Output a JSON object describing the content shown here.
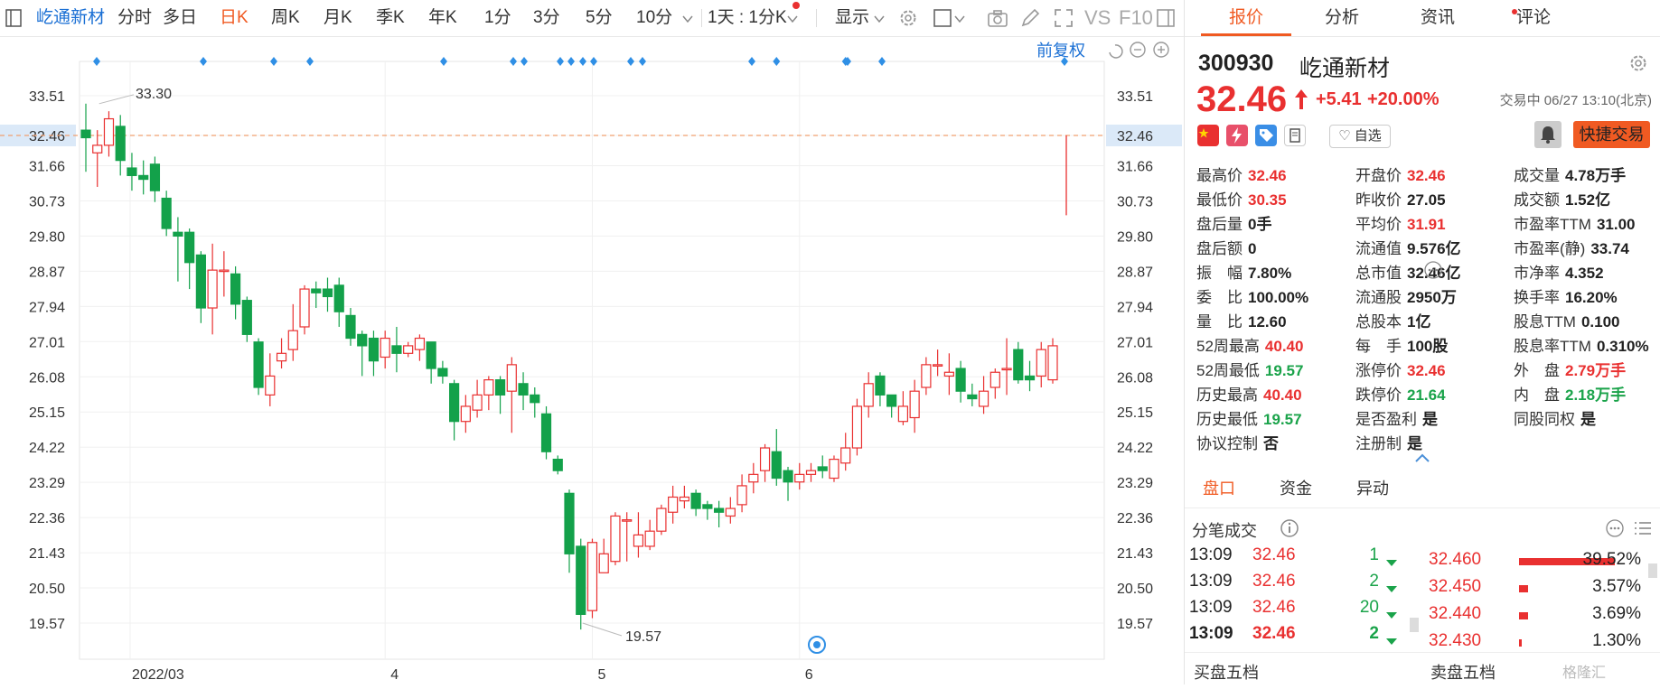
{
  "toolbar": {
    "stock_name": "屹通新材",
    "periods": [
      "分时",
      "多日",
      "日K",
      "周K",
      "月K",
      "季K",
      "年K",
      "1分",
      "3分",
      "5分",
      "10分"
    ],
    "active_period": "日K",
    "day_select": "1天 : 1分K",
    "display": "显示",
    "vs": "VS",
    "f10": "F10"
  },
  "chart": {
    "fuquan": "前复权",
    "current_price_label": "32.46",
    "max_label": "33.30",
    "min_label": "19.57",
    "accent_up": "#e93030",
    "accent_down": "#13a14a",
    "price_line_color": "#f0a070"
  },
  "chart_data": {
    "type": "candlestick",
    "y_ticks": [
      33.51,
      32.46,
      31.66,
      30.73,
      29.8,
      28.87,
      27.94,
      27.01,
      26.08,
      25.15,
      24.22,
      23.29,
      22.36,
      21.43,
      20.5,
      19.57
    ],
    "ylim": [
      19.06,
      34.27
    ],
    "x_labels": [
      {
        "index": 4,
        "label": "2022/03"
      },
      {
        "index": 26,
        "label": "4"
      },
      {
        "index": 44,
        "label": "5"
      },
      {
        "index": 62,
        "label": "6"
      }
    ],
    "candles": [
      [
        32.6,
        32.4,
        33.3,
        31.5
      ],
      [
        32.0,
        32.2,
        32.6,
        31.1
      ],
      [
        32.2,
        32.9,
        33.1,
        31.9
      ],
      [
        32.7,
        31.8,
        33.0,
        31.4
      ],
      [
        31.6,
        31.4,
        32.0,
        31.0
      ],
      [
        31.4,
        31.3,
        31.8,
        30.9
      ],
      [
        31.7,
        31.0,
        31.9,
        30.7
      ],
      [
        30.8,
        30.0,
        31.0,
        29.8
      ],
      [
        29.9,
        29.8,
        30.3,
        28.6
      ],
      [
        29.9,
        29.1,
        30.0,
        28.4
      ],
      [
        29.3,
        27.9,
        29.4,
        27.5
      ],
      [
        27.9,
        28.9,
        29.6,
        27.2
      ],
      [
        28.9,
        28.9,
        29.4,
        28.2
      ],
      [
        28.8,
        28.0,
        29.0,
        27.6
      ],
      [
        28.1,
        27.2,
        28.2,
        27.0
      ],
      [
        27.0,
        25.8,
        27.1,
        25.6
      ],
      [
        25.6,
        26.1,
        26.7,
        25.3
      ],
      [
        26.5,
        26.7,
        27.1,
        26.3
      ],
      [
        26.8,
        27.3,
        28.0,
        26.5
      ],
      [
        27.4,
        28.4,
        28.5,
        27.2
      ],
      [
        28.4,
        28.3,
        28.6,
        27.9
      ],
      [
        28.4,
        28.2,
        28.7,
        27.8
      ],
      [
        28.5,
        27.8,
        28.7,
        27.4
      ],
      [
        27.7,
        27.1,
        27.9,
        26.9
      ],
      [
        27.2,
        26.9,
        27.3,
        26.1
      ],
      [
        27.1,
        26.5,
        27.3,
        26.1
      ],
      [
        26.6,
        27.1,
        27.3,
        26.3
      ],
      [
        26.9,
        26.7,
        27.4,
        26.2
      ],
      [
        26.7,
        26.9,
        27.0,
        26.6
      ],
      [
        26.8,
        27.1,
        27.2,
        26.5
      ],
      [
        27.0,
        26.3,
        27.0,
        25.9
      ],
      [
        26.3,
        26.1,
        26.5,
        25.9
      ],
      [
        25.9,
        24.9,
        26.0,
        24.4
      ],
      [
        24.9,
        25.3,
        25.6,
        24.6
      ],
      [
        25.2,
        25.6,
        26.0,
        25.0
      ],
      [
        25.6,
        26.0,
        26.1,
        25.2
      ],
      [
        26.0,
        25.6,
        26.1,
        25.1
      ],
      [
        25.7,
        26.4,
        26.6,
        24.6
      ],
      [
        25.9,
        25.6,
        26.2,
        25.2
      ],
      [
        25.6,
        25.4,
        25.8,
        25.0
      ],
      [
        25.1,
        24.1,
        25.3,
        23.9
      ],
      [
        23.9,
        23.6,
        24.0,
        23.5
      ],
      [
        23.0,
        21.4,
        23.1,
        20.9
      ],
      [
        21.6,
        19.8,
        21.8,
        19.4
      ],
      [
        19.9,
        21.7,
        21.8,
        19.7
      ],
      [
        20.9,
        21.4,
        21.8,
        20.9
      ],
      [
        21.2,
        22.4,
        22.5,
        21.1
      ],
      [
        22.3,
        22.3,
        22.5,
        21.2
      ],
      [
        21.6,
        21.9,
        22.5,
        21.3
      ],
      [
        21.6,
        22.0,
        22.3,
        21.5
      ],
      [
        22.0,
        22.6,
        22.7,
        21.9
      ],
      [
        22.5,
        22.9,
        23.2,
        22.2
      ],
      [
        22.8,
        22.9,
        23.2,
        22.6
      ],
      [
        23.0,
        22.6,
        23.1,
        22.4
      ],
      [
        22.7,
        22.6,
        22.8,
        22.3
      ],
      [
        22.6,
        22.5,
        22.8,
        22.1
      ],
      [
        22.4,
        22.6,
        22.9,
        22.2
      ],
      [
        22.7,
        23.2,
        23.5,
        22.5
      ],
      [
        23.3,
        23.5,
        23.8,
        23.0
      ],
      [
        23.6,
        24.2,
        24.3,
        23.3
      ],
      [
        24.1,
        23.4,
        24.7,
        23.2
      ],
      [
        23.6,
        23.3,
        23.7,
        22.8
      ],
      [
        23.3,
        23.5,
        23.8,
        23.1
      ],
      [
        23.5,
        23.6,
        23.8,
        23.3
      ],
      [
        23.7,
        23.6,
        24.0,
        23.4
      ],
      [
        23.4,
        23.9,
        24.0,
        23.3
      ],
      [
        23.8,
        24.2,
        24.6,
        23.6
      ],
      [
        24.2,
        25.3,
        25.5,
        24.0
      ],
      [
        25.3,
        25.9,
        26.2,
        25.0
      ],
      [
        26.1,
        25.6,
        26.2,
        25.3
      ],
      [
        25.6,
        25.3,
        25.6,
        25.0
      ],
      [
        24.9,
        25.3,
        25.7,
        24.8
      ],
      [
        25.0,
        25.7,
        26.0,
        24.6
      ],
      [
        25.8,
        26.4,
        26.6,
        25.6
      ],
      [
        26.4,
        26.4,
        26.8,
        26.1
      ],
      [
        26.1,
        26.2,
        26.7,
        25.6
      ],
      [
        26.3,
        25.7,
        26.5,
        25.4
      ],
      [
        25.6,
        25.5,
        25.9,
        25.3
      ],
      [
        25.3,
        25.7,
        26.1,
        25.1
      ],
      [
        25.8,
        26.2,
        26.3,
        25.5
      ],
      [
        26.3,
        26.3,
        27.1,
        25.6
      ],
      [
        26.8,
        26.0,
        27.0,
        25.9
      ],
      [
        26.1,
        26.0,
        26.5,
        25.7
      ],
      [
        26.1,
        26.8,
        27.0,
        25.8
      ],
      [
        26.0,
        26.9,
        27.1,
        25.9
      ]
    ],
    "today": {
      "open": 32.46,
      "close": 32.46,
      "high": 32.46,
      "low": 30.35
    },
    "markers_count": 19
  },
  "quote": {
    "tabs": [
      "报价",
      "分析",
      "资讯",
      "评论"
    ],
    "active_tab": "报价",
    "code": "300930",
    "name": "屹通新材",
    "price": "32.46",
    "change": "+5.41",
    "change_pct": "+20.00%",
    "status": "交易中 06/27 13:10(北京)",
    "fav": "自选",
    "quick_trade": "快捷交易",
    "fields": [
      [
        {
          "l": "最高价",
          "v": "32.46",
          "c": "red"
        },
        {
          "l": "开盘价",
          "v": "32.46",
          "c": "red"
        },
        {
          "l": "成交量",
          "v": "4.78万手",
          "c": "dark"
        }
      ],
      [
        {
          "l": "最低价",
          "v": "30.35",
          "c": "red"
        },
        {
          "l": "昨收价",
          "v": "27.05",
          "c": "dark"
        },
        {
          "l": "成交额",
          "v": "1.52亿",
          "c": "dark"
        }
      ],
      [
        {
          "l": "盘后量",
          "v": "0手",
          "c": "dark"
        },
        {
          "l": "平均价",
          "v": "31.91",
          "c": "red"
        },
        {
          "l": "市盈率TTM",
          "v": "31.00",
          "c": "dark"
        }
      ],
      [
        {
          "l": "盘后额",
          "v": "0",
          "c": "dark"
        },
        {
          "l": "流通值",
          "v": "9.576亿",
          "c": "dark"
        },
        {
          "l": "市盈率(静)",
          "v": "33.74",
          "c": "dark"
        }
      ],
      [
        {
          "l": "振　幅",
          "v": "7.80%",
          "c": "dark"
        },
        {
          "l": "总市值",
          "v": "32.46亿",
          "c": "dark"
        },
        {
          "l": "市净率",
          "v": "4.352",
          "c": "dark"
        }
      ],
      [
        {
          "l": "委　比",
          "v": "100.00%",
          "c": "dark"
        },
        {
          "l": "流通股",
          "v": "2950万",
          "c": "dark"
        },
        {
          "l": "换手率",
          "v": "16.20%",
          "c": "dark"
        }
      ],
      [
        {
          "l": "量　比",
          "v": "12.60",
          "c": "dark"
        },
        {
          "l": "总股本",
          "v": "1亿",
          "c": "dark"
        },
        {
          "l": "股息TTM",
          "v": "0.100",
          "c": "dark"
        }
      ],
      [
        {
          "l": "52周最高",
          "v": "40.40",
          "c": "red"
        },
        {
          "l": "每　手",
          "v": "100股",
          "c": "dark"
        },
        {
          "l": "股息率TTM",
          "v": "0.310%",
          "c": "dark"
        }
      ],
      [
        {
          "l": "52周最低",
          "v": "19.57",
          "c": "green"
        },
        {
          "l": "涨停价",
          "v": "32.46",
          "c": "red"
        },
        {
          "l": "外　盘",
          "v": "2.79万手",
          "c": "red"
        }
      ],
      [
        {
          "l": "历史最高",
          "v": "40.40",
          "c": "red"
        },
        {
          "l": "跌停价",
          "v": "21.64",
          "c": "green"
        },
        {
          "l": "内　盘",
          "v": "2.18万手",
          "c": "green"
        }
      ],
      [
        {
          "l": "历史最低",
          "v": "19.57",
          "c": "green"
        },
        {
          "l": "是否盈利",
          "v": "是",
          "c": "dark"
        },
        {
          "l": "同股同权",
          "v": "是",
          "c": "dark"
        }
      ],
      [
        {
          "l": "协议控制",
          "v": "否",
          "c": "dark"
        },
        {
          "l": "注册制",
          "v": "是",
          "c": "dark"
        },
        {
          "l": "",
          "v": "",
          "c": "dark"
        }
      ]
    ],
    "subtabs": [
      "盘口",
      "资金",
      "异动"
    ],
    "active_subtab": "盘口",
    "ticks_title": "分笔成交",
    "ticks": [
      {
        "t": "13:09",
        "p": "32.46",
        "q": "1"
      },
      {
        "t": "13:09",
        "p": "32.46",
        "q": "2"
      },
      {
        "t": "13:09",
        "p": "32.46",
        "q": "20"
      },
      {
        "t": "13:09",
        "p": "32.46",
        "q": "2"
      }
    ],
    "depth": [
      {
        "p": "32.460",
        "pct": "39.52%",
        "w": 0.95
      },
      {
        "p": "32.450",
        "pct": "3.57%",
        "w": 0.09
      },
      {
        "p": "32.440",
        "pct": "3.69%",
        "w": 0.09
      },
      {
        "p": "32.430",
        "pct": "1.30%",
        "w": 0.03
      }
    ],
    "buy5": "买盘五档",
    "sell5": "卖盘五档",
    "watermark": "格隆汇"
  }
}
